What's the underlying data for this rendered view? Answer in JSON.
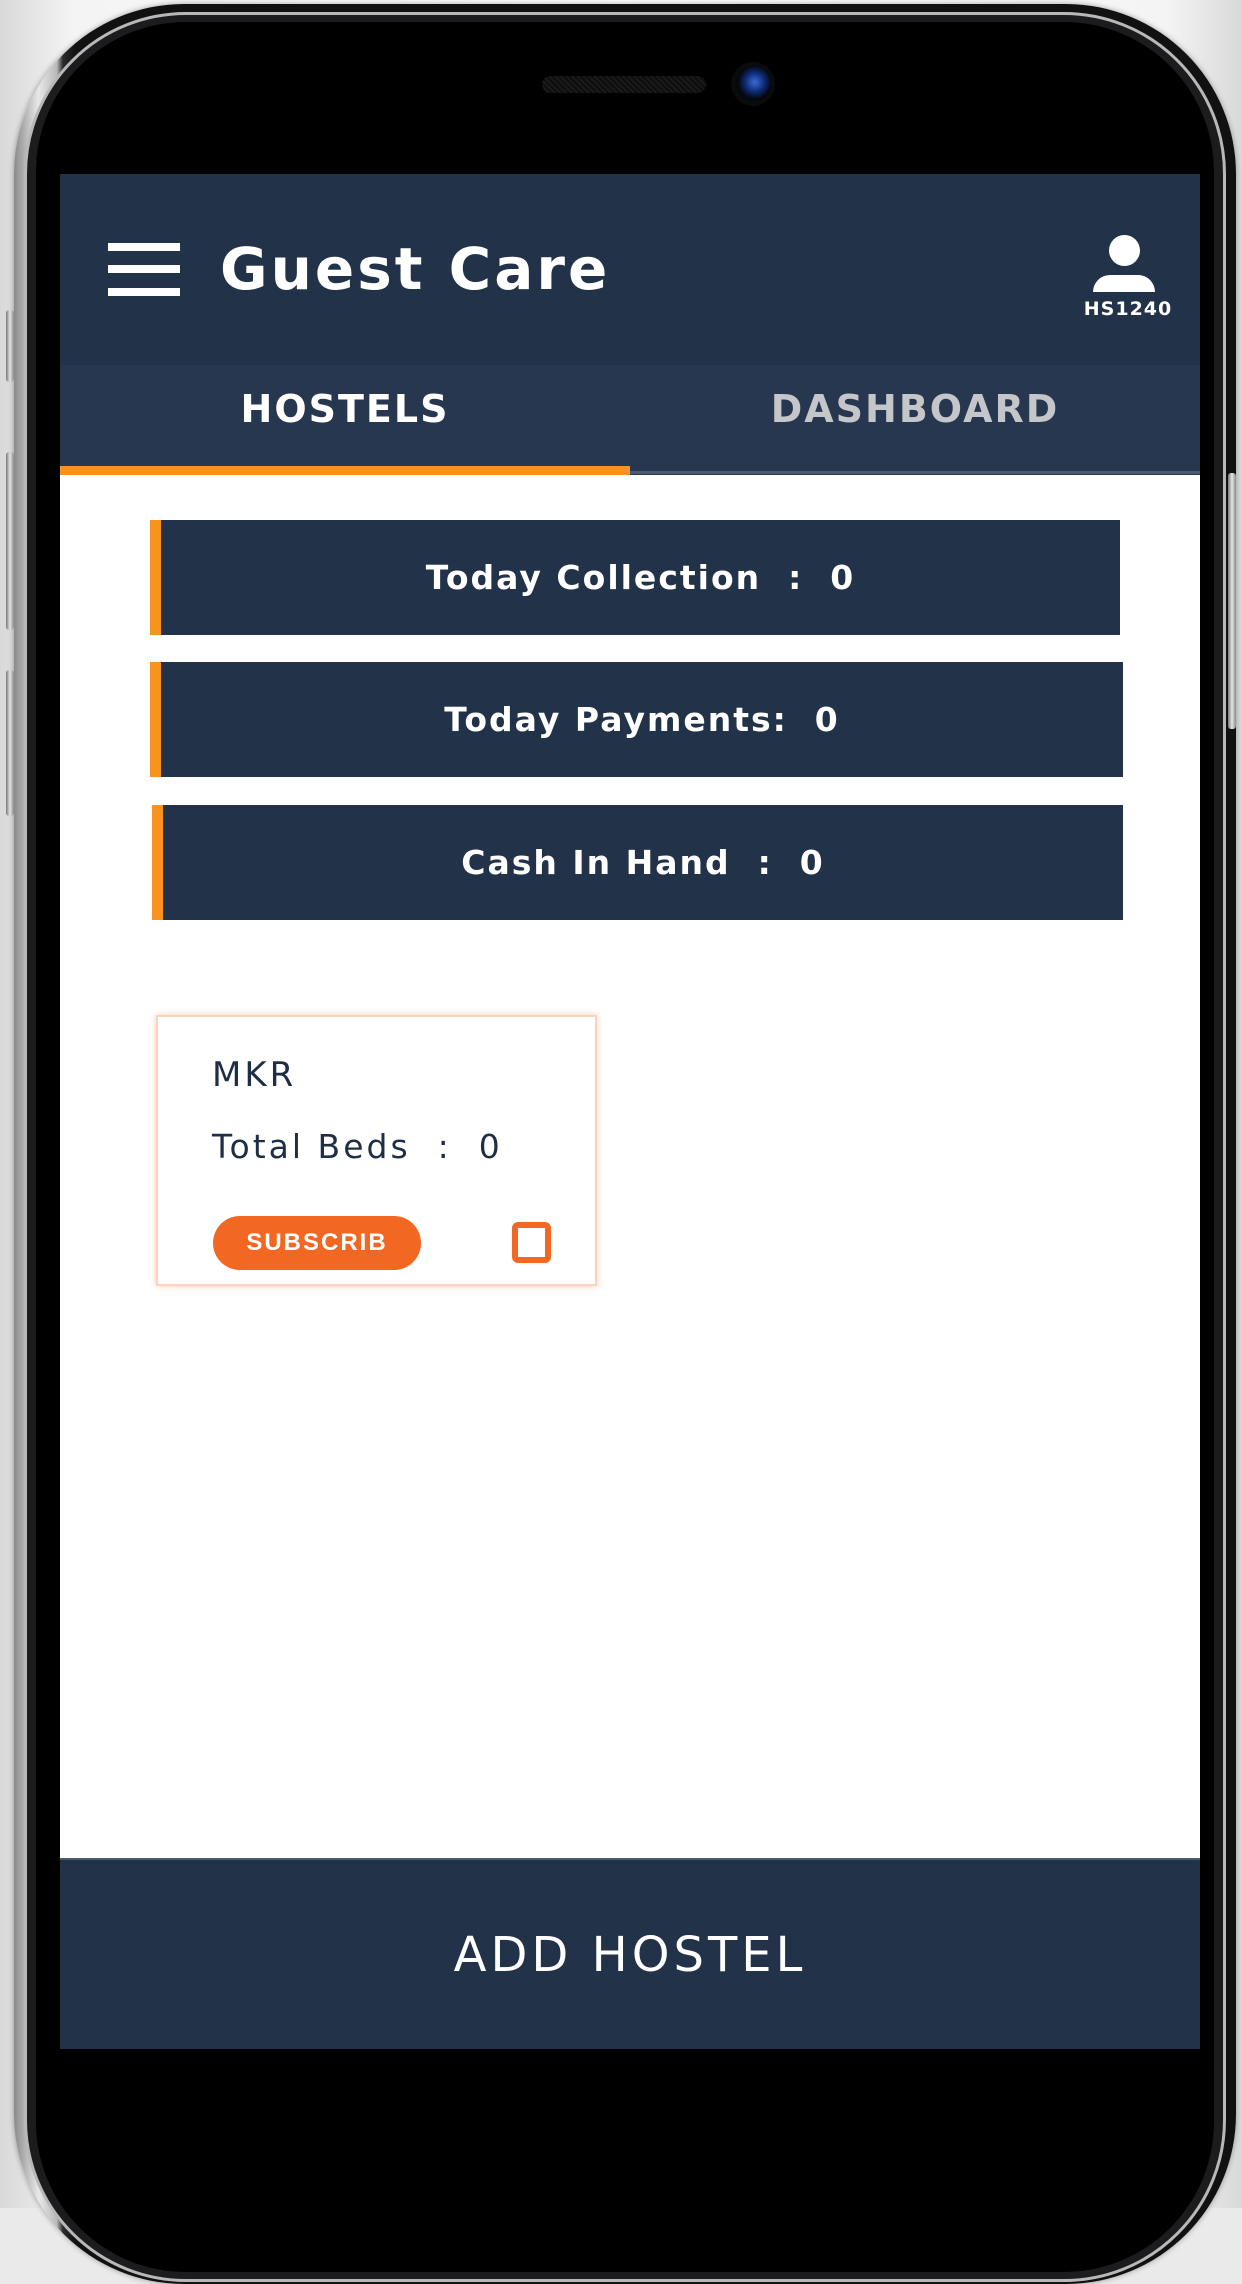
{
  "header": {
    "title": "Guest Care",
    "user_id": "HS1240",
    "menu_icon": "hamburger-menu-icon",
    "profile_icon": "user-profile-icon"
  },
  "tabs": [
    {
      "label": "HOSTELS",
      "active": true
    },
    {
      "label": "DASHBOARD",
      "active": false
    }
  ],
  "stats": [
    {
      "label": "Today Collection  :  0"
    },
    {
      "label": "Today Payments:  0"
    },
    {
      "label": "Cash In Hand  :  0"
    }
  ],
  "hostels": [
    {
      "name": "MKR",
      "beds_label": "Total Beds  :  0",
      "subscribe_label": "SUBSCRIB",
      "checked": false
    }
  ],
  "footer": {
    "add_button_label": "ADD HOSTEL"
  },
  "colors": {
    "primary_navy": "#213249",
    "tab_bar": "#26374f",
    "accent_orange": "#f7931e",
    "subscribe_orange": "#f26722",
    "inactive_tab_text": "#c4c6c9"
  }
}
